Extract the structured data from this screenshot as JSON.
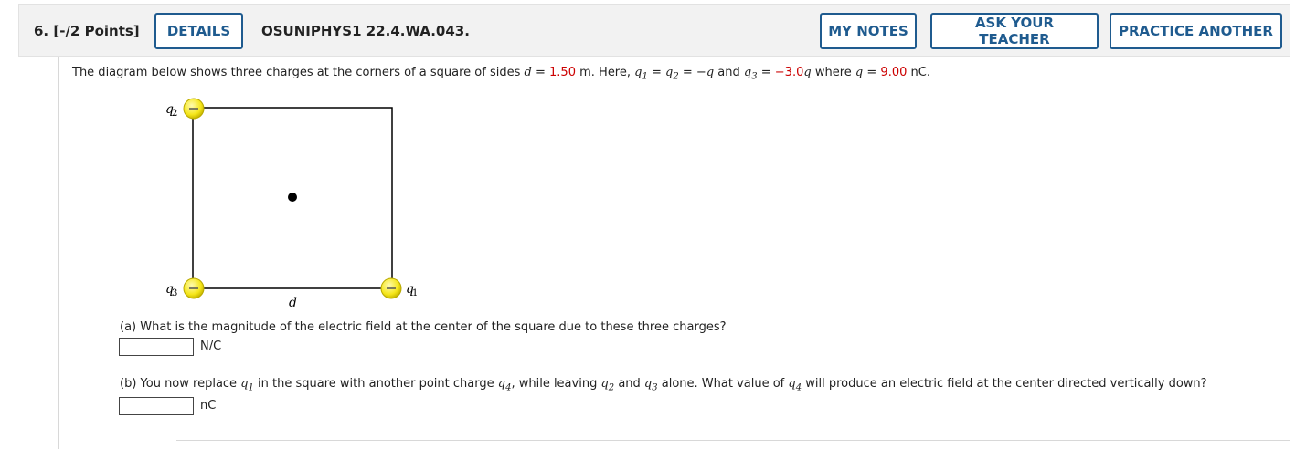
{
  "header": {
    "question_number": "6.",
    "points": "[-/2 Points]",
    "details_label": "DETAILS",
    "code": "OSUNIPHYS1 22.4.WA.043.",
    "my_notes_label": "MY NOTES",
    "ask_teacher_label": "ASK YOUR TEACHER",
    "practice_label": "PRACTICE ANOTHER"
  },
  "problem": {
    "intro": "The diagram below shows three charges at the corners of a square of sides",
    "d_var": "d",
    "eq": "=",
    "d_value": "1.50",
    "d_unit": "m. Here,",
    "q_relation_mid": "and",
    "q3_value": "−3.0",
    "where_text": "where",
    "q_value": "9.00",
    "q_unit": "nC."
  },
  "diagram": {
    "q1_label": "q",
    "q1_sub": "1",
    "q2_label": "q2",
    "q3_label": "q3",
    "side_label": "d",
    "charge_sign": "−"
  },
  "part_a": {
    "question": "(a) What is the magnitude of the electric field at the center of the square due to these three charges?",
    "unit": "N/C",
    "value": ""
  },
  "part_b": {
    "text_1": "(b) You now replace",
    "text_2": "in the square with another point charge",
    "text_3": ", while leaving",
    "text_4": "and",
    "text_5": "alone. What value of",
    "text_6": "will produce an electric field at the center directed vertically down?",
    "unit": "nC",
    "value": ""
  },
  "colors": {
    "accent": "#1f5b8f",
    "highlight": "#cc0000",
    "charge_fill": "#f5e61a"
  }
}
